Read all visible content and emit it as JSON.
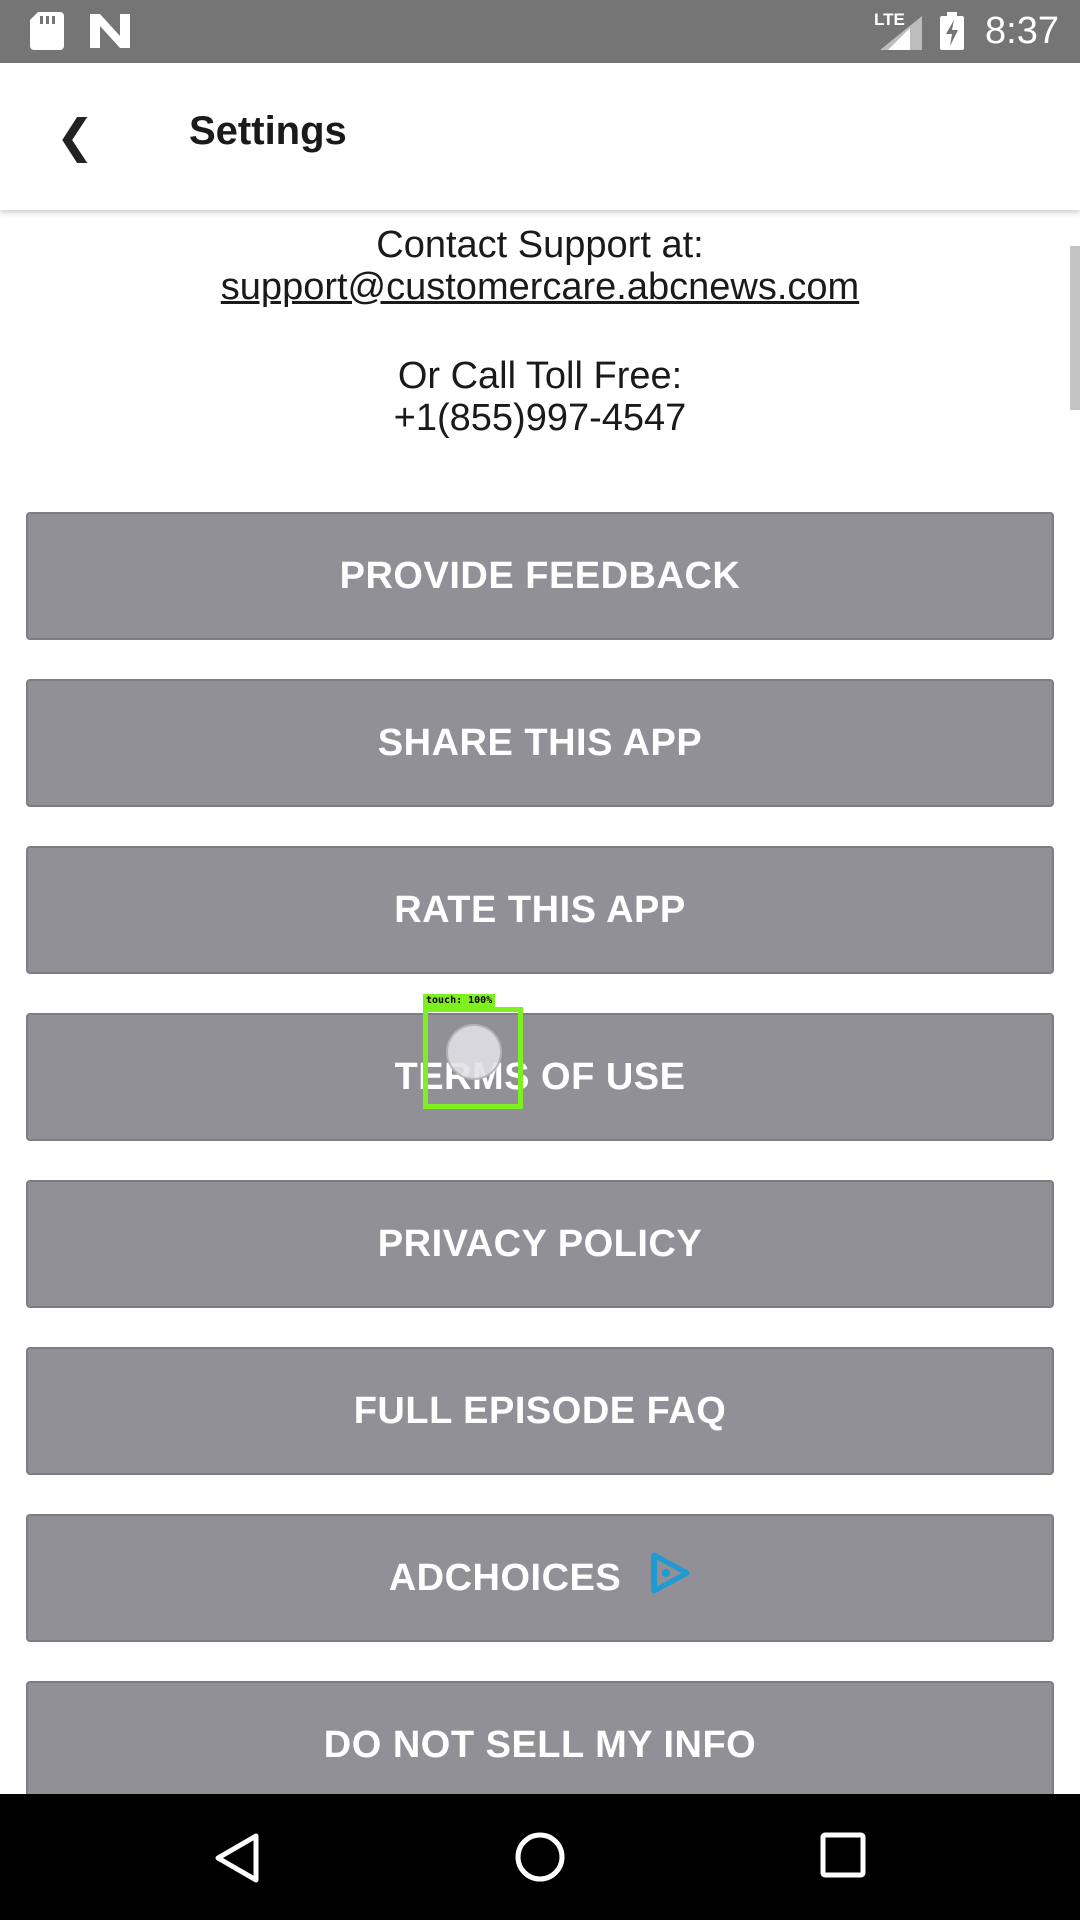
{
  "status_bar": {
    "network": "LTE",
    "time": "8:37",
    "icons": [
      "sd-card-icon",
      "n-notification-icon",
      "signal-icon",
      "battery-charging-icon"
    ]
  },
  "header": {
    "title": "Settings",
    "back_icon": "❮"
  },
  "contact": {
    "support_label": "Contact Support at:",
    "support_email": "support@customercare.abcnews.com",
    "call_label": "Or Call Toll Free:",
    "phone": "+1(855)997-4547"
  },
  "buttons": [
    {
      "label": "PROVIDE FEEDBACK"
    },
    {
      "label": "SHARE THIS APP"
    },
    {
      "label": "RATE THIS APP"
    },
    {
      "label": "TERMS OF USE"
    },
    {
      "label": "PRIVACY POLICY"
    },
    {
      "label": "FULL EPISODE FAQ"
    },
    {
      "label": "ADCHOICES",
      "icon": "adchoices-icon"
    },
    {
      "label": "DO NOT SELL MY INFO"
    }
  ],
  "touch_overlay": {
    "label": "touch: 100%"
  },
  "colors": {
    "status_bar": "#757575",
    "button_bg": "#919096",
    "button_text": "#ffffff",
    "adchoices_accent": "#1e9bd2",
    "touch_box": "#7ef01f",
    "nav_bar": "#000000"
  },
  "nav_bar": {
    "icons": [
      "back-icon",
      "home-icon",
      "recents-icon"
    ]
  }
}
